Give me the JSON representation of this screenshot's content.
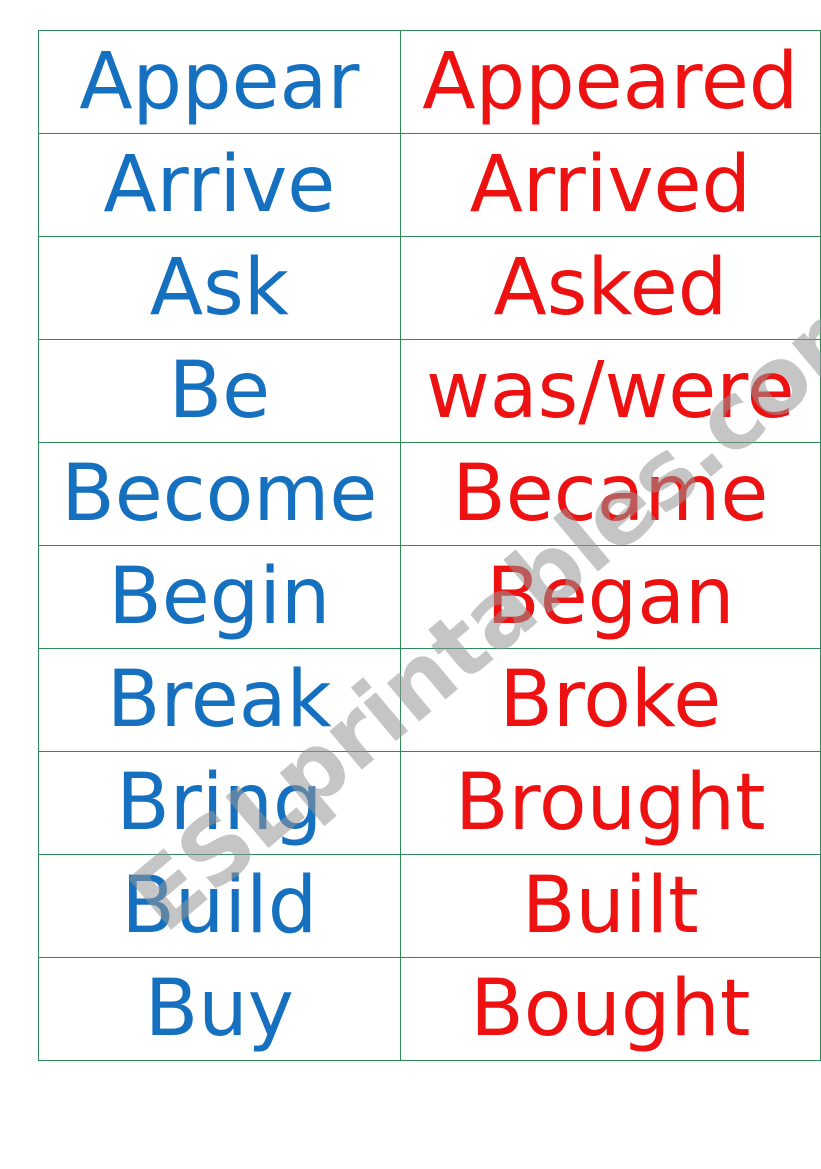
{
  "rows": [
    {
      "base": "Appear",
      "past": "Appeared"
    },
    {
      "base": "Arrive",
      "past": "Arrived"
    },
    {
      "base": "Ask",
      "past": "Asked"
    },
    {
      "base": "Be",
      "past": "was/were"
    },
    {
      "base": "Become",
      "past": "Became"
    },
    {
      "base": "Begin",
      "past": "Began"
    },
    {
      "base": "Break",
      "past": "Broke"
    },
    {
      "base": "Bring",
      "past": "Brought"
    },
    {
      "base": "Build",
      "past": "Built"
    },
    {
      "base": "Buy",
      "past": "Bought"
    }
  ],
  "watermark": "ESLprintables.com",
  "colors": {
    "base": "#1570c0",
    "past": "#ee1111",
    "grid": "#2e8b57"
  }
}
